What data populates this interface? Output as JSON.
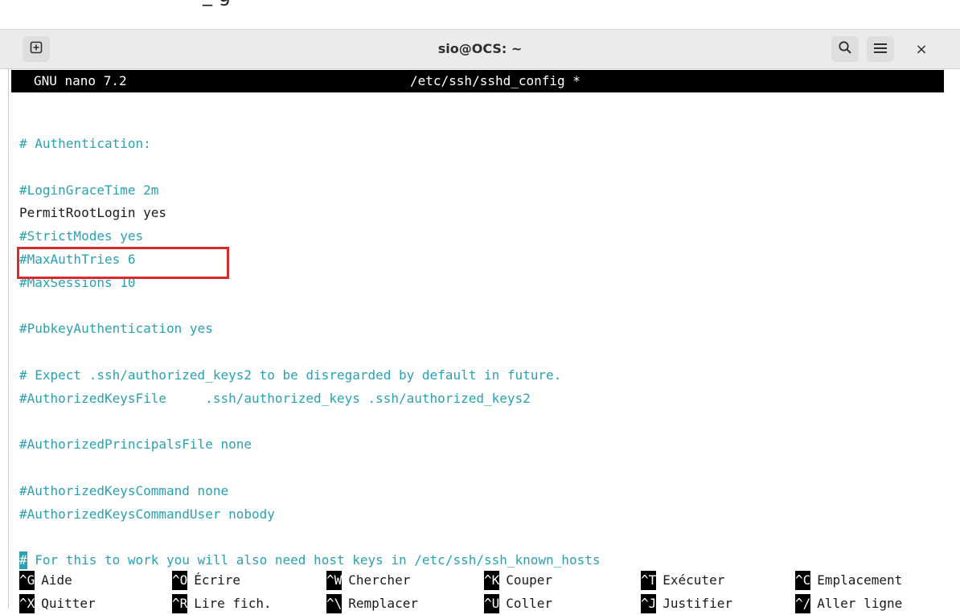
{
  "background_fragment": "_ g",
  "window": {
    "title": "sio@OCS: ~",
    "buttons": {
      "new_tab_icon": "plus-square-icon",
      "search_icon": "search-icon",
      "menu_icon": "hamburger-menu-icon",
      "close_label": "×"
    }
  },
  "nano": {
    "version": "GNU nano 7.2",
    "file": "/etc/ssh/sshd_config *",
    "lines": [
      {
        "text": "# Authentication:",
        "style": "comment"
      },
      {
        "text": "",
        "style": "comment"
      },
      {
        "text": "#LoginGraceTime 2m",
        "style": "comment"
      },
      {
        "text": "PermitRootLogin yes",
        "style": "plain"
      },
      {
        "text": "#StrictModes yes",
        "style": "comment"
      },
      {
        "text": "#MaxAuthTries 6",
        "style": "comment"
      },
      {
        "text": "#MaxSessions 10",
        "style": "comment"
      },
      {
        "text": "",
        "style": "comment"
      },
      {
        "text": "#PubkeyAuthentication yes",
        "style": "comment"
      },
      {
        "text": "",
        "style": "comment"
      },
      {
        "text": "# Expect .ssh/authorized_keys2 to be disregarded by default in future.",
        "style": "comment"
      },
      {
        "text": "#AuthorizedKeysFile     .ssh/authorized_keys .ssh/authorized_keys2",
        "style": "comment"
      },
      {
        "text": "",
        "style": "comment"
      },
      {
        "text": "#AuthorizedPrincipalsFile none",
        "style": "comment"
      },
      {
        "text": "",
        "style": "comment"
      },
      {
        "text": "#AuthorizedKeysCommand none",
        "style": "comment"
      },
      {
        "text": "#AuthorizedKeysCommandUser nobody",
        "style": "comment"
      },
      {
        "text": "",
        "style": "comment"
      },
      {
        "cursor_char": "#",
        "text": " For this to work you will also need host keys in /etc/ssh/ssh_known_hosts",
        "style": "comment"
      }
    ],
    "shortcuts_row1": [
      {
        "key": "^G",
        "label": "Aide"
      },
      {
        "key": "^O",
        "label": "Écrire"
      },
      {
        "key": "^W",
        "label": "Chercher"
      },
      {
        "key": "^K",
        "label": "Couper"
      },
      {
        "key": "^T",
        "label": "Exécuter"
      },
      {
        "key": "^C",
        "label": "Emplacement"
      }
    ],
    "shortcuts_row2": [
      {
        "key": "^X",
        "label": "Quitter"
      },
      {
        "key": "^R",
        "label": "Lire fich."
      },
      {
        "key": "^\\",
        "label": "Remplacer"
      },
      {
        "key": "^U",
        "label": "Coller"
      },
      {
        "key": "^J",
        "label": "Justifier"
      },
      {
        "key": "^/",
        "label": "Aller ligne"
      }
    ]
  },
  "colors": {
    "comment": "#2aa1b3",
    "highlight_border": "#d82a2a",
    "header_bg": "#000000"
  }
}
